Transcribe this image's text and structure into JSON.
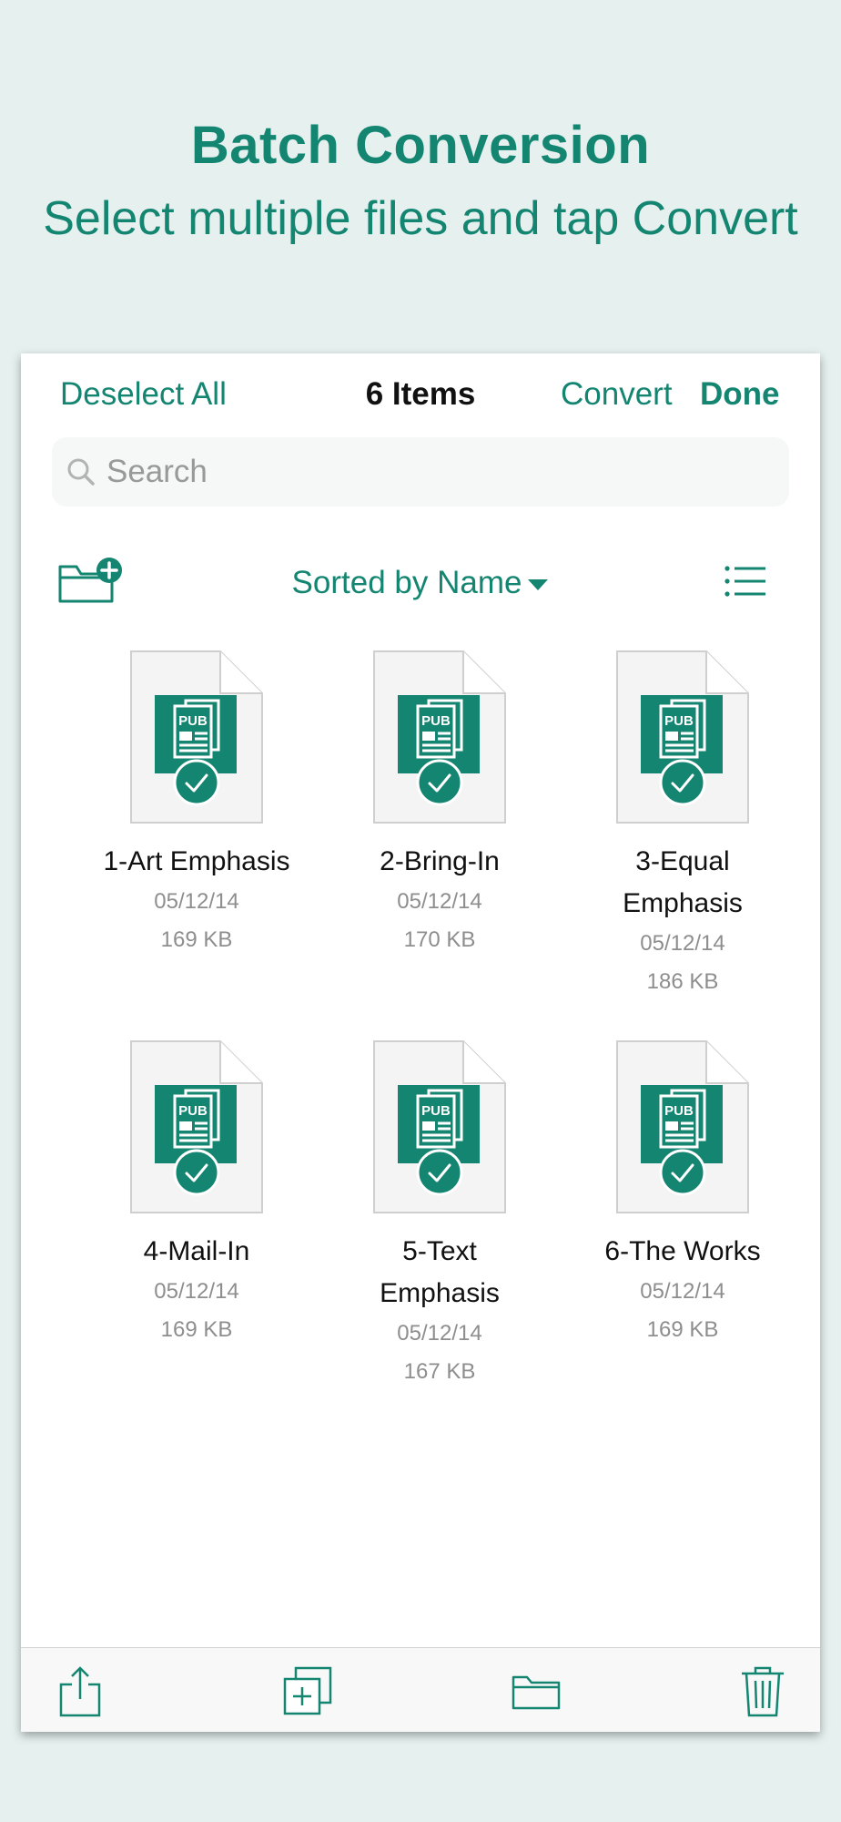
{
  "promo": {
    "title": "Batch Conversion",
    "subtitle": "Select multiple files and tap Convert"
  },
  "nav": {
    "deselect_label": "Deselect All",
    "title": "6 Items",
    "convert_label": "Convert",
    "done_label": "Done"
  },
  "search": {
    "placeholder": "Search",
    "value": "",
    "icon": "search-icon"
  },
  "toolbar": {
    "new_folder_icon": "new-folder-icon",
    "sort_label": "Sorted by Name",
    "sort_icon": "caret-down-icon",
    "view_icon": "list-view-icon"
  },
  "files": [
    {
      "name": "1-Art Emphasis",
      "date": "05/12/14",
      "size": "169 KB",
      "badge": "PUB",
      "selected": true
    },
    {
      "name": "2-Bring-In",
      "date": "05/12/14",
      "size": "170 KB",
      "badge": "PUB",
      "selected": true
    },
    {
      "name": "3-Equal Emphasis",
      "date": "05/12/14",
      "size": "186 KB",
      "badge": "PUB",
      "selected": true
    },
    {
      "name": "4-Mail-In",
      "date": "05/12/14",
      "size": "169 KB",
      "badge": "PUB",
      "selected": true
    },
    {
      "name": "5-Text Emphasis",
      "date": "05/12/14",
      "size": "167 KB",
      "badge": "PUB",
      "selected": true
    },
    {
      "name": "6-The Works",
      "date": "05/12/14",
      "size": "169 KB",
      "badge": "PUB",
      "selected": true
    }
  ],
  "bottom_bar": {
    "icons": [
      "share-icon",
      "duplicate-icon",
      "folder-icon",
      "trash-icon"
    ]
  },
  "colors": {
    "accent": "#148571",
    "background": "#e6f1ef",
    "secondary_text": "#8e8e8e"
  }
}
